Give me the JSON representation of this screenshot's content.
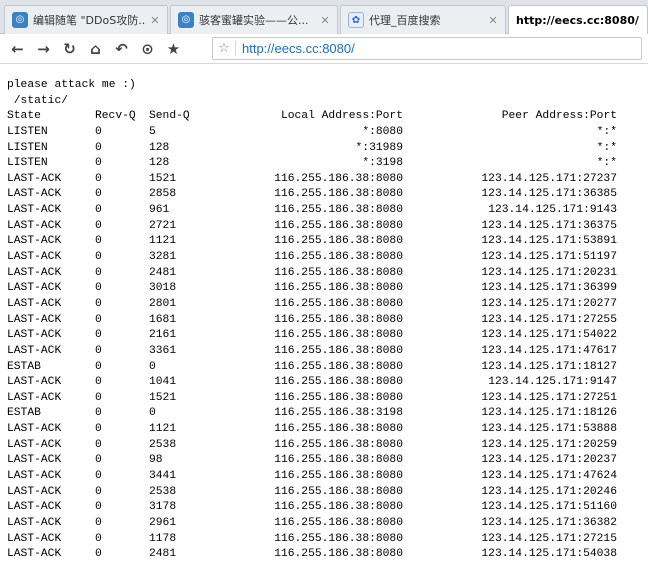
{
  "tabs": [
    {
      "title": "编辑随笔 \"DDoS攻防...",
      "icon": "circle-logo-icon",
      "active": false
    },
    {
      "title": "骇客蜜罐实验——公...",
      "icon": "circle-logo-icon",
      "active": false
    },
    {
      "title": "代理_百度搜索",
      "icon": "baidu-paw-icon",
      "active": false
    },
    {
      "title": "http://eecs.cc:8080/",
      "icon": "",
      "active": true
    }
  ],
  "toolbar": {
    "back": "←",
    "forward": "→",
    "reload": "↻",
    "home": "⌂",
    "undo": "↶",
    "history": "⊙",
    "favorite": "★",
    "address_star": "☆",
    "url": "http://eecs.cc:8080/"
  },
  "page": {
    "greeting": "please attack me :)",
    "link": " /static/",
    "headers": {
      "state": "State",
      "recv": "Recv-Q",
      "send": "Send-Q",
      "local": "Local Address:Port",
      "peer": "Peer Address:Port"
    },
    "rows": [
      {
        "state": "LISTEN",
        "recv": "0",
        "send": "5",
        "local": "*:8080",
        "peer": "*:*"
      },
      {
        "state": "LISTEN",
        "recv": "0",
        "send": "128",
        "local": "*:31989",
        "peer": "*:*"
      },
      {
        "state": "LISTEN",
        "recv": "0",
        "send": "128",
        "local": "*:3198",
        "peer": "*:*"
      },
      {
        "state": "LAST-ACK",
        "recv": "0",
        "send": "1521",
        "local": "116.255.186.38:8080",
        "peer": "123.14.125.171:27237"
      },
      {
        "state": "LAST-ACK",
        "recv": "0",
        "send": "2858",
        "local": "116.255.186.38:8080",
        "peer": "123.14.125.171:36385"
      },
      {
        "state": "LAST-ACK",
        "recv": "0",
        "send": "961",
        "local": "116.255.186.38:8080",
        "peer": "123.14.125.171:9143"
      },
      {
        "state": "LAST-ACK",
        "recv": "0",
        "send": "2721",
        "local": "116.255.186.38:8080",
        "peer": "123.14.125.171:36375"
      },
      {
        "state": "LAST-ACK",
        "recv": "0",
        "send": "1121",
        "local": "116.255.186.38:8080",
        "peer": "123.14.125.171:53891"
      },
      {
        "state": "LAST-ACK",
        "recv": "0",
        "send": "3281",
        "local": "116.255.186.38:8080",
        "peer": "123.14.125.171:51197"
      },
      {
        "state": "LAST-ACK",
        "recv": "0",
        "send": "2481",
        "local": "116.255.186.38:8080",
        "peer": "123.14.125.171:20231"
      },
      {
        "state": "LAST-ACK",
        "recv": "0",
        "send": "3018",
        "local": "116.255.186.38:8080",
        "peer": "123.14.125.171:36399"
      },
      {
        "state": "LAST-ACK",
        "recv": "0",
        "send": "2801",
        "local": "116.255.186.38:8080",
        "peer": "123.14.125.171:20277"
      },
      {
        "state": "LAST-ACK",
        "recv": "0",
        "send": "1681",
        "local": "116.255.186.38:8080",
        "peer": "123.14.125.171:27255"
      },
      {
        "state": "LAST-ACK",
        "recv": "0",
        "send": "2161",
        "local": "116.255.186.38:8080",
        "peer": "123.14.125.171:54022"
      },
      {
        "state": "LAST-ACK",
        "recv": "0",
        "send": "3361",
        "local": "116.255.186.38:8080",
        "peer": "123.14.125.171:47617"
      },
      {
        "state": "ESTAB",
        "recv": "0",
        "send": "0",
        "local": "116.255.186.38:8080",
        "peer": "123.14.125.171:18127"
      },
      {
        "state": "LAST-ACK",
        "recv": "0",
        "send": "1041",
        "local": "116.255.186.38:8080",
        "peer": "123.14.125.171:9147"
      },
      {
        "state": "LAST-ACK",
        "recv": "0",
        "send": "1521",
        "local": "116.255.186.38:8080",
        "peer": "123.14.125.171:27251"
      },
      {
        "state": "ESTAB",
        "recv": "0",
        "send": "0",
        "local": "116.255.186.38:3198",
        "peer": "123.14.125.171:18126"
      },
      {
        "state": "LAST-ACK",
        "recv": "0",
        "send": "1121",
        "local": "116.255.186.38:8080",
        "peer": "123.14.125.171:53888"
      },
      {
        "state": "LAST-ACK",
        "recv": "0",
        "send": "2538",
        "local": "116.255.186.38:8080",
        "peer": "123.14.125.171:20259"
      },
      {
        "state": "LAST-ACK",
        "recv": "0",
        "send": "98",
        "local": "116.255.186.38:8080",
        "peer": "123.14.125.171:20237"
      },
      {
        "state": "LAST-ACK",
        "recv": "0",
        "send": "3441",
        "local": "116.255.186.38:8080",
        "peer": "123.14.125.171:47624"
      },
      {
        "state": "LAST-ACK",
        "recv": "0",
        "send": "2538",
        "local": "116.255.186.38:8080",
        "peer": "123.14.125.171:20246"
      },
      {
        "state": "LAST-ACK",
        "recv": "0",
        "send": "3178",
        "local": "116.255.186.38:8080",
        "peer": "123.14.125.171:51160"
      },
      {
        "state": "LAST-ACK",
        "recv": "0",
        "send": "2961",
        "local": "116.255.186.38:8080",
        "peer": "123.14.125.171:36382"
      },
      {
        "state": "LAST-ACK",
        "recv": "0",
        "send": "1178",
        "local": "116.255.186.38:8080",
        "peer": "123.14.125.171:27215"
      },
      {
        "state": "LAST-ACK",
        "recv": "0",
        "send": "2481",
        "local": "116.255.186.38:8080",
        "peer": "123.14.125.171:54038"
      }
    ]
  }
}
